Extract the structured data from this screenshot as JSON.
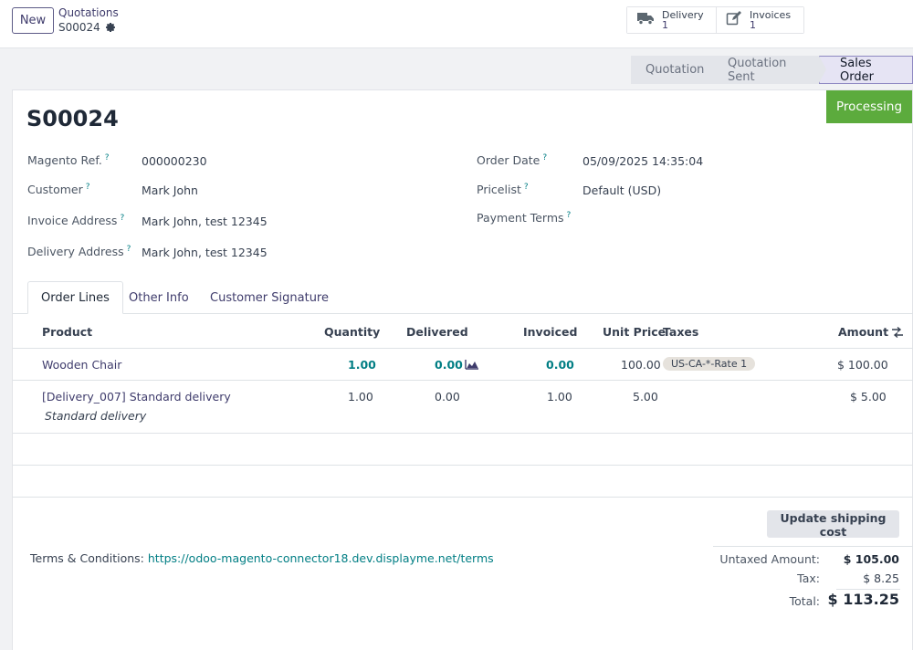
{
  "topbar": {
    "new_label": "New",
    "breadcrumb_parent": "Quotations",
    "breadcrumb_current": "S00024",
    "smart_buttons": {
      "delivery": {
        "label": "Delivery",
        "count": "1"
      },
      "invoices": {
        "label": "Invoices",
        "count": "1"
      }
    }
  },
  "statusbar": {
    "stages": [
      "Quotation",
      "Quotation Sent",
      "Sales Order"
    ],
    "active": "Sales Order"
  },
  "ribbon": {
    "label": "Processing",
    "color": "#5cab3d"
  },
  "order": {
    "name": "S00024",
    "fields_left": [
      {
        "label": "Magento Ref.",
        "value": "000000230"
      },
      {
        "label": "Customer",
        "value": "Mark John"
      },
      {
        "label": "Invoice Address",
        "value": "Mark John, test 12345"
      },
      {
        "label": "Delivery Address",
        "value": "Mark John, test 12345"
      }
    ],
    "fields_right": [
      {
        "label": "Order Date",
        "value": "05/09/2025 14:35:04"
      },
      {
        "label": "Pricelist",
        "value": "Default (USD)"
      },
      {
        "label": "Payment Terms",
        "value": ""
      }
    ],
    "help_mark": "?"
  },
  "tabs": [
    "Order Lines",
    "Other Info",
    "Customer Signature"
  ],
  "table": {
    "headers": {
      "product": "Product",
      "quantity": "Quantity",
      "delivered": "Delivered",
      "invoiced": "Invoiced",
      "unit_price": "Unit Price",
      "taxes": "Taxes",
      "amount": "Amount"
    },
    "rows": [
      {
        "product": "Wooden Chair",
        "quantity": "1.00",
        "delivered": "0.00",
        "invoiced": "0.00",
        "unit_price": "100.00",
        "taxes": "US-CA-*-Rate 1",
        "amount": "$ 100.00"
      },
      {
        "product": "[Delivery_007] Standard delivery",
        "description": "Standard delivery",
        "quantity": "1.00",
        "delivered": "0.00",
        "invoiced": "1.00",
        "unit_price": "5.00",
        "taxes": "",
        "amount": "$ 5.00"
      }
    ]
  },
  "footer": {
    "update_shipping_label": "Update shipping cost",
    "terms_label": "Terms & Conditions:",
    "terms_link": "https://odoo-magento-connector18.dev.displayme.net/terms",
    "totals": {
      "untaxed_label": "Untaxed Amount:",
      "untaxed_value": "$ 105.00",
      "tax_label": "Tax:",
      "tax_value": "$ 8.25",
      "total_label": "Total:",
      "total_value": "$ 113.25"
    }
  },
  "colors": {
    "primary": "#3f3c6c",
    "link": "#017e84",
    "ribbon": "#5cab3d"
  }
}
